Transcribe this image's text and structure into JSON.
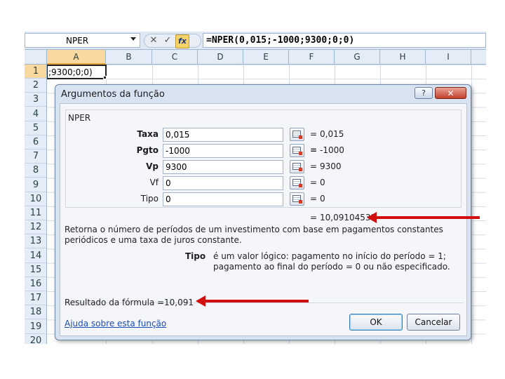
{
  "formula_bar": {
    "name_box": "NPER",
    "formula": "=NPER(0,015;-1000;9300;0;0)",
    "cancel_glyph": "✕",
    "enter_glyph": "✓",
    "fx_label": "fx"
  },
  "columns": [
    "A",
    "B",
    "C",
    "D",
    "E",
    "F",
    "G",
    "H",
    "I"
  ],
  "rows": [
    "1",
    "2",
    "3",
    "4",
    "5",
    "6",
    "7",
    "8",
    "9",
    "10",
    "11",
    "12",
    "13",
    "14",
    "15",
    "16",
    "17",
    "18",
    "19",
    "20"
  ],
  "active_cell_text": ";9300;0;0)",
  "dialog": {
    "title": "Argumentos da função",
    "help_glyph": "?",
    "close_glyph": "✕",
    "function_name": "NPER",
    "arguments": [
      {
        "label": "Taxa",
        "input": "0,015",
        "result": "0,015"
      },
      {
        "label": "Pgto",
        "input": "-1000",
        "result": "-1000"
      },
      {
        "label": "Vp",
        "input": "9300",
        "result": "9300"
      },
      {
        "label": "Vf",
        "input": "0",
        "result": "0"
      },
      {
        "label": "Tipo",
        "input": "0",
        "result": "0"
      }
    ],
    "equals_sign": "=",
    "overall_result": "10,09104531",
    "description": "Retorna o número de períodos de um investimento com base em pagamentos constantes periódicos e uma taxa de juros constante.",
    "arg_help_name": "Tipo",
    "arg_help_text": "é um valor lógico: pagamento no início do período = 1; pagamento ao final do período = 0 ou não especificado.",
    "formula_result_label": "Resultado da fórmula =",
    "formula_result_value": "10,091",
    "help_link": "Ajuda sobre esta função",
    "ok_label": "OK",
    "cancel_label": "Cancelar"
  },
  "colors": {
    "arrow": "#d10f0f",
    "dialog_bg": "#d8e3f1",
    "header_bg": "#e4ecf7",
    "selected_header": "#f9d99f"
  },
  "icons": [
    "dropdown-arrow-icon",
    "cancel-x-icon",
    "enter-check-icon",
    "function-fx-icon",
    "range-picker-icon",
    "help-icon",
    "close-icon"
  ]
}
